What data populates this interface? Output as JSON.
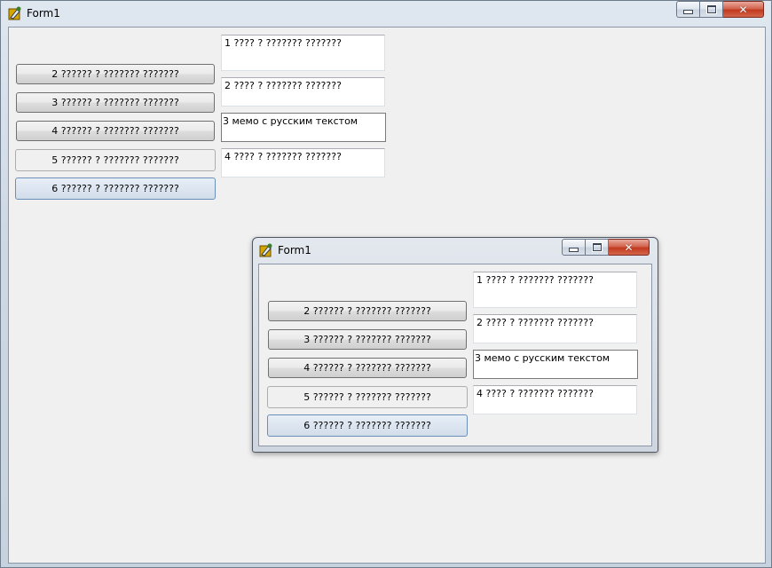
{
  "main_window": {
    "title": "Form1",
    "buttons": [
      {
        "label": "2 ?????? ? ??????? ???????"
      },
      {
        "label": "3 ?????? ? ??????? ???????"
      },
      {
        "label": "4 ?????? ? ??????? ???????"
      },
      {
        "label": "5 ?????? ? ??????? ???????"
      },
      {
        "label": "6 ?????? ? ??????? ???????"
      }
    ],
    "memos": [
      {
        "text": "1 ???? ? ??????? ???????"
      },
      {
        "text": "2 ???? ? ??????? ???????"
      },
      {
        "text": "3 мемо с русским текстом"
      },
      {
        "text": "4 ???? ? ??????? ???????"
      }
    ]
  },
  "child_window": {
    "title": "Form1",
    "buttons": [
      {
        "label": "2 ?????? ? ??????? ???????"
      },
      {
        "label": "3 ?????? ? ??????? ???????"
      },
      {
        "label": "4 ?????? ? ??????? ???????"
      },
      {
        "label": "5 ?????? ? ??????? ???????"
      },
      {
        "label": "6 ?????? ? ??????? ???????"
      }
    ],
    "memos": [
      {
        "text": "1 ???? ? ??????? ???????"
      },
      {
        "text": "2 ???? ? ??????? ???????"
      },
      {
        "text": "3 мемо с русским текстом"
      },
      {
        "text": "4 ???? ? ??????? ???????"
      }
    ]
  },
  "icons": {
    "app": "delphi-app-icon",
    "minimize": "minimize-icon",
    "maximize": "maximize-icon",
    "close": "close-icon"
  },
  "colors": {
    "client_bg": "#f0f0f0",
    "close_button": "#c2391f",
    "hot_button": "#bee6fd"
  }
}
